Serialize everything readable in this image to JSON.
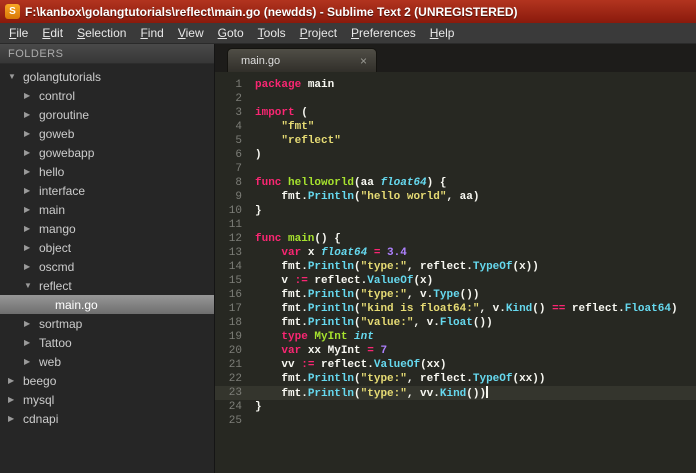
{
  "window": {
    "title": "F:\\kanbox\\golangtutorials\\reflect\\main.go (newdds) - Sublime Text 2 (UNREGISTERED)",
    "icon_glyph": "S"
  },
  "menu": {
    "items": [
      "File",
      "Edit",
      "Selection",
      "Find",
      "View",
      "Goto",
      "Tools",
      "Project",
      "Preferences",
      "Help"
    ]
  },
  "sidebar": {
    "header": "FOLDERS",
    "icons": {
      "collapsed": "▶",
      "expanded": "▼"
    },
    "tree": [
      {
        "label": "golangtutorials",
        "depth": 0,
        "state": "expanded"
      },
      {
        "label": "control",
        "depth": 1,
        "state": "collapsed"
      },
      {
        "label": "goroutine",
        "depth": 1,
        "state": "collapsed"
      },
      {
        "label": "goweb",
        "depth": 1,
        "state": "collapsed"
      },
      {
        "label": "gowebapp",
        "depth": 1,
        "state": "collapsed"
      },
      {
        "label": "hello",
        "depth": 1,
        "state": "collapsed"
      },
      {
        "label": "interface",
        "depth": 1,
        "state": "collapsed"
      },
      {
        "label": "main",
        "depth": 1,
        "state": "collapsed"
      },
      {
        "label": "mango",
        "depth": 1,
        "state": "collapsed"
      },
      {
        "label": "object",
        "depth": 1,
        "state": "collapsed"
      },
      {
        "label": "oscmd",
        "depth": 1,
        "state": "collapsed"
      },
      {
        "label": "reflect",
        "depth": 1,
        "state": "expanded"
      },
      {
        "label": "main.go",
        "depth": 2,
        "state": "file",
        "selected": true
      },
      {
        "label": "sortmap",
        "depth": 1,
        "state": "collapsed"
      },
      {
        "label": "Tattoo",
        "depth": 1,
        "state": "collapsed"
      },
      {
        "label": "web",
        "depth": 1,
        "state": "collapsed"
      },
      {
        "label": "beego",
        "depth": 0,
        "state": "collapsed"
      },
      {
        "label": "mysql",
        "depth": 0,
        "state": "collapsed"
      },
      {
        "label": "cdnapi",
        "depth": 0,
        "state": "collapsed"
      }
    ]
  },
  "tabs": [
    {
      "label": "main.go",
      "active": true,
      "close_icon": "×"
    }
  ],
  "colors": {
    "titlebar": "#8a1a0c",
    "editor_bg": "#272822",
    "keyword": "#f92672",
    "function": "#a6e22e",
    "type": "#66d9ef",
    "string": "#e6db74",
    "number": "#ae81ff",
    "plain": "#f8f8f2",
    "selected_row": "#7c7c7c"
  },
  "editor": {
    "current_line": 23,
    "lines": [
      {
        "n": 1,
        "tk": [
          [
            "kw",
            "package"
          ],
          [
            "pl",
            " main"
          ]
        ]
      },
      {
        "n": 2,
        "tk": []
      },
      {
        "n": 3,
        "tk": [
          [
            "kw",
            "import"
          ],
          [
            "pl",
            " ("
          ]
        ]
      },
      {
        "n": 4,
        "tk": [
          [
            "pl",
            "    "
          ],
          [
            "str",
            "\"fmt\""
          ]
        ]
      },
      {
        "n": 5,
        "tk": [
          [
            "pl",
            "    "
          ],
          [
            "str",
            "\"reflect\""
          ]
        ]
      },
      {
        "n": 6,
        "tk": [
          [
            "pl",
            ")"
          ]
        ]
      },
      {
        "n": 7,
        "tk": []
      },
      {
        "n": 8,
        "tk": [
          [
            "kw",
            "func"
          ],
          [
            "fn",
            " helloworld"
          ],
          [
            "pl",
            "(aa "
          ],
          [
            "ty",
            "float64"
          ],
          [
            "pl",
            ") {"
          ]
        ]
      },
      {
        "n": 9,
        "tk": [
          [
            "pl",
            "    fmt."
          ],
          [
            "call",
            "Println"
          ],
          [
            "pl",
            "("
          ],
          [
            "str",
            "\"hello world\""
          ],
          [
            "pl",
            ", aa)"
          ]
        ]
      },
      {
        "n": 10,
        "tk": [
          [
            "pl",
            "}"
          ]
        ]
      },
      {
        "n": 11,
        "tk": []
      },
      {
        "n": 12,
        "tk": [
          [
            "kw",
            "func"
          ],
          [
            "fn",
            " main"
          ],
          [
            "pl",
            "() {"
          ]
        ]
      },
      {
        "n": 13,
        "tk": [
          [
            "pl",
            "    "
          ],
          [
            "kw",
            "var"
          ],
          [
            "pl",
            " x "
          ],
          [
            "ty",
            "float64"
          ],
          [
            "kw",
            " ="
          ],
          [
            "num",
            " 3.4"
          ]
        ]
      },
      {
        "n": 14,
        "tk": [
          [
            "pl",
            "    fmt."
          ],
          [
            "call",
            "Println"
          ],
          [
            "pl",
            "("
          ],
          [
            "str",
            "\"type:\""
          ],
          [
            "pl",
            ", reflect."
          ],
          [
            "call",
            "TypeOf"
          ],
          [
            "pl",
            "(x))"
          ]
        ]
      },
      {
        "n": 15,
        "tk": [
          [
            "pl",
            "    v "
          ],
          [
            "kw",
            ":="
          ],
          [
            "pl",
            " reflect."
          ],
          [
            "call",
            "ValueOf"
          ],
          [
            "pl",
            "(x)"
          ]
        ]
      },
      {
        "n": 16,
        "tk": [
          [
            "pl",
            "    fmt."
          ],
          [
            "call",
            "Println"
          ],
          [
            "pl",
            "("
          ],
          [
            "str",
            "\"type:\""
          ],
          [
            "pl",
            ", v."
          ],
          [
            "call",
            "Type"
          ],
          [
            "pl",
            "())"
          ]
        ]
      },
      {
        "n": 17,
        "tk": [
          [
            "pl",
            "    fmt."
          ],
          [
            "call",
            "Println"
          ],
          [
            "pl",
            "("
          ],
          [
            "str",
            "\"kind is float64:\""
          ],
          [
            "pl",
            ", v."
          ],
          [
            "call",
            "Kind"
          ],
          [
            "pl",
            "() "
          ],
          [
            "kw",
            "=="
          ],
          [
            "pl",
            " reflect."
          ],
          [
            "call",
            "Float64"
          ],
          [
            "pl",
            ")"
          ]
        ]
      },
      {
        "n": 18,
        "tk": [
          [
            "pl",
            "    fmt."
          ],
          [
            "call",
            "Println"
          ],
          [
            "pl",
            "("
          ],
          [
            "str",
            "\"value:\""
          ],
          [
            "pl",
            ", v."
          ],
          [
            "call",
            "Float"
          ],
          [
            "pl",
            "())"
          ]
        ]
      },
      {
        "n": 19,
        "tk": [
          [
            "pl",
            "    "
          ],
          [
            "kw",
            "type"
          ],
          [
            "fn",
            " MyInt"
          ],
          [
            "ty",
            " int"
          ]
        ]
      },
      {
        "n": 20,
        "tk": [
          [
            "pl",
            "    "
          ],
          [
            "kw",
            "var"
          ],
          [
            "pl",
            " xx MyInt "
          ],
          [
            "kw",
            "="
          ],
          [
            "num",
            " 7"
          ]
        ]
      },
      {
        "n": 21,
        "tk": [
          [
            "pl",
            "    vv "
          ],
          [
            "kw",
            ":="
          ],
          [
            "pl",
            " reflect."
          ],
          [
            "call",
            "ValueOf"
          ],
          [
            "pl",
            "(xx)"
          ]
        ]
      },
      {
        "n": 22,
        "tk": [
          [
            "pl",
            "    fmt."
          ],
          [
            "call",
            "Println"
          ],
          [
            "pl",
            "("
          ],
          [
            "str",
            "\"type:\""
          ],
          [
            "pl",
            ", reflect."
          ],
          [
            "call",
            "TypeOf"
          ],
          [
            "pl",
            "(xx))"
          ]
        ]
      },
      {
        "n": 23,
        "tk": [
          [
            "pl",
            "    fmt."
          ],
          [
            "call",
            "Println"
          ],
          [
            "pl",
            "("
          ],
          [
            "str",
            "\"type:\""
          ],
          [
            "pl",
            ", vv."
          ],
          [
            "call",
            "Kind"
          ],
          [
            "pl",
            "())"
          ]
        ],
        "cursor": true
      },
      {
        "n": 24,
        "tk": [
          [
            "pl",
            "}"
          ]
        ]
      },
      {
        "n": 25,
        "tk": []
      }
    ]
  }
}
